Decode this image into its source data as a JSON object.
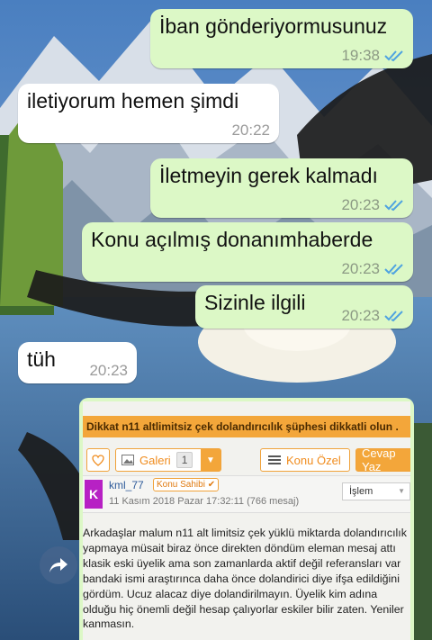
{
  "messages": [
    {
      "dir": "out",
      "text": "İban gönderiyormusunuz",
      "time": "19:38",
      "read": true
    },
    {
      "dir": "in",
      "text": "iletiyorum hemen şimdi",
      "time": "20:22"
    },
    {
      "dir": "out",
      "text": "İletmeyin gerek kalmadı",
      "time": "20:23",
      "read": true
    },
    {
      "dir": "out",
      "text": "Konu açılmış donanımhaberde",
      "time": "20:23",
      "read": true
    },
    {
      "dir": "out",
      "text": "Sizinle ilgili",
      "time": "20:23",
      "read": true
    },
    {
      "dir": "in",
      "text": "tüh",
      "time": "20:23"
    }
  ],
  "forum": {
    "topic_title": "Dikkat n11 altlimitsiz çek dolandırıcılık şüphesi dikkatli olun .",
    "gallery_label": "Galeri",
    "gallery_count": "1",
    "private_label": "Konu Özel",
    "reply_label": "Cevap Yaz",
    "avatar_letter": "K",
    "username": "kml_77",
    "owner_badge": "Konu Sahibi",
    "post_date": "11 Kasım 2018 Pazar 17:32:11 (766 mesaj)",
    "action_label": "İşlem",
    "body_lines": [
      "Arkadaşlar malum n11 alt limitsiz çek yüklü miktarda dolandırıcılık",
      "yapmaya müsait biraz önce direkten döndüm eleman mesaj attı",
      "klasik eski üyelik ama son zamanlarda aktif değil referansları var",
      "bandaki ismi araştırınca daha önce dolandirici diye ifşa edildiğini",
      "gördüm. Ucuz alacaz diye dolandirilmayın. Üyelik kim adına",
      "olduğu hiç önemli değil hesap çalıyorlar eskiler bilir zaten. Yeniler",
      "kanmasın."
    ]
  },
  "colors": {
    "outgoing_bubble": "#dcf8c6",
    "incoming_bubble": "#ffffff",
    "read_ticks": "#4fa3e0",
    "forum_accent": "#f3a63a"
  },
  "icons": [
    "double-check-icon",
    "heart-icon",
    "image-icon",
    "menu-icon",
    "check-icon",
    "forward-icon",
    "chevron-down-icon"
  ]
}
